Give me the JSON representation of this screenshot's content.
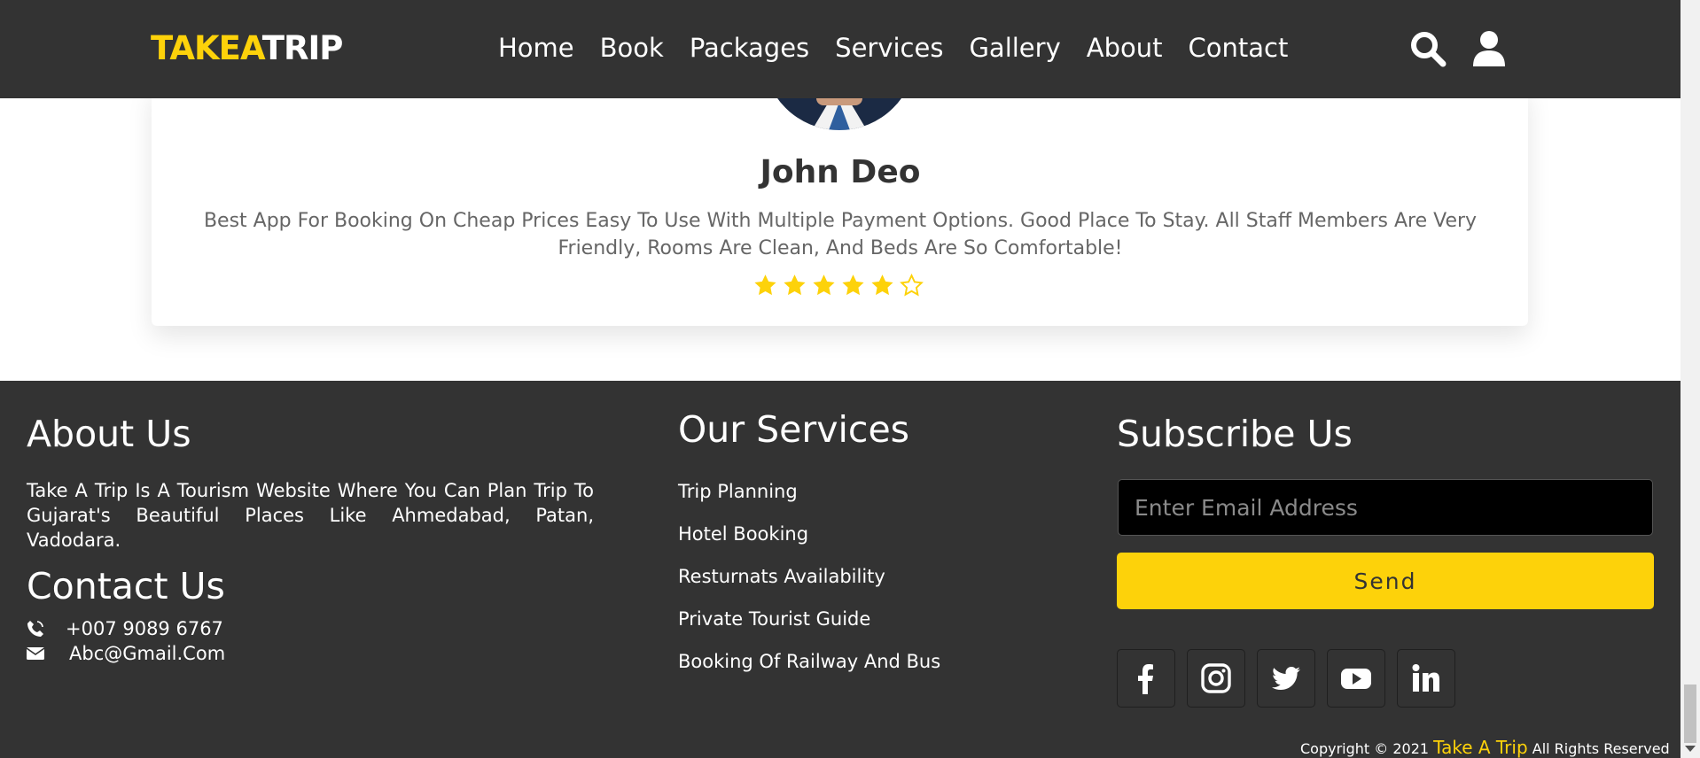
{
  "navbar": {
    "logo_part1": "TAKEA",
    "logo_part2": "TRIP",
    "links": [
      "Home",
      "Book",
      "Packages",
      "Services",
      "Gallery",
      "About",
      "Contact"
    ],
    "icons": [
      "search-icon",
      "user-icon"
    ]
  },
  "testimonial": {
    "name": "John Deo",
    "text": "Best App For Booking On Cheap Prices Easy To Use With Multiple Payment Options. Good Place To Stay. All Staff Members Are Very Friendly, Rooms Are Clean, And Beds Are So Comfortable!",
    "rating": 5,
    "rating_max": 6
  },
  "footer": {
    "about": {
      "heading": "About Us",
      "text": "Take A Trip Is A Tourism Website Where You Can Plan Trip To Gujarat's Beautiful Places Like Ahmedabad, Patan, Vadodara."
    },
    "contact": {
      "heading": "Contact Us",
      "phone": "+007 9089 6767",
      "email": "Abc@Gmail.Com"
    },
    "services": {
      "heading": "Our Services",
      "items": [
        "Trip Planning",
        "Hotel Booking",
        "Resturnats Availability",
        "Private Tourist Guide",
        "Booking Of Railway And Bus"
      ]
    },
    "subscribe": {
      "heading": "Subscribe Us",
      "placeholder": "Enter Email Address",
      "button": "Send"
    },
    "socials": [
      "facebook-icon",
      "instagram-icon",
      "twitter-icon",
      "youtube-icon",
      "linkedin-icon"
    ],
    "copyright": {
      "prefix": "Copyright © 2021",
      "brand": "Take A Trip",
      "suffix": "All Rights Reserved"
    }
  },
  "colors": {
    "accent": "#fdd20a",
    "dark": "#333333",
    "muted_text": "#666666"
  }
}
